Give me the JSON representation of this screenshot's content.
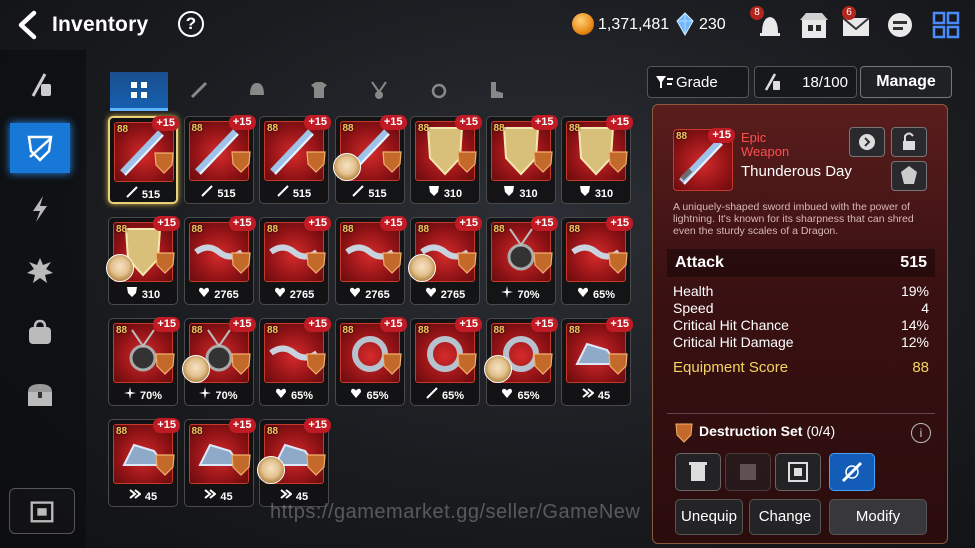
{
  "header": {
    "title": "Inventory",
    "help": "?",
    "gold": "1,371,481",
    "gems": "230",
    "badges": {
      "bell": "8",
      "mail": "6"
    }
  },
  "category_tabs": [
    "all",
    "weapon",
    "helmet",
    "armor",
    "necklace",
    "ring",
    "boots"
  ],
  "toolbar": {
    "filter_label": "Grade",
    "capacity": "18/100",
    "manage_label": "Manage"
  },
  "items": [
    {
      "lv": "88",
      "plus": "+15",
      "stat_icon": "sword",
      "value": "515",
      "hero": false
    },
    {
      "lv": "88",
      "plus": "+15",
      "stat_icon": "sword",
      "value": "515",
      "hero": false
    },
    {
      "lv": "88",
      "plus": "+15",
      "stat_icon": "sword",
      "value": "515",
      "hero": false
    },
    {
      "lv": "88",
      "plus": "+15",
      "stat_icon": "sword",
      "value": "515",
      "hero": true
    },
    {
      "lv": "88",
      "plus": "+15",
      "stat_icon": "shield",
      "value": "310",
      "hero": false
    },
    {
      "lv": "88",
      "plus": "+15",
      "stat_icon": "shield",
      "value": "310",
      "hero": false
    },
    {
      "lv": "88",
      "plus": "+15",
      "stat_icon": "shield",
      "value": "310",
      "hero": false
    },
    {
      "lv": "88",
      "plus": "+15",
      "stat_icon": "shield",
      "value": "310",
      "hero": true
    },
    {
      "lv": "88",
      "plus": "+15",
      "stat_icon": "heart",
      "value": "2765",
      "hero": false
    },
    {
      "lv": "88",
      "plus": "+15",
      "stat_icon": "heart",
      "value": "2765",
      "hero": false
    },
    {
      "lv": "88",
      "plus": "+15",
      "stat_icon": "heart",
      "value": "2765",
      "hero": false
    },
    {
      "lv": "88",
      "plus": "+15",
      "stat_icon": "heart",
      "value": "2765",
      "hero": true
    },
    {
      "lv": "88",
      "plus": "+15",
      "stat_icon": "crit",
      "value": "70%",
      "hero": false
    },
    {
      "lv": "88",
      "plus": "+15",
      "stat_icon": "heart",
      "value": "65%",
      "hero": false
    },
    {
      "lv": "88",
      "plus": "+15",
      "stat_icon": "crit",
      "value": "70%",
      "hero": false
    },
    {
      "lv": "88",
      "plus": "+15",
      "stat_icon": "crit",
      "value": "70%",
      "hero": true
    },
    {
      "lv": "88",
      "plus": "+15",
      "stat_icon": "heart",
      "value": "65%",
      "hero": false
    },
    {
      "lv": "88",
      "plus": "+15",
      "stat_icon": "heart",
      "value": "65%",
      "hero": false
    },
    {
      "lv": "88",
      "plus": "+15",
      "stat_icon": "sword",
      "value": "65%",
      "hero": false
    },
    {
      "lv": "88",
      "plus": "+15",
      "stat_icon": "heart",
      "value": "65%",
      "hero": true
    },
    {
      "lv": "88",
      "plus": "+15",
      "stat_icon": "speed",
      "value": "45",
      "hero": false
    },
    {
      "lv": "88",
      "plus": "+15",
      "stat_icon": "speed",
      "value": "45",
      "hero": false
    },
    {
      "lv": "88",
      "plus": "+15",
      "stat_icon": "speed",
      "value": "45",
      "hero": false
    },
    {
      "lv": "88",
      "plus": "+15",
      "stat_icon": "speed",
      "value": "45",
      "hero": true
    }
  ],
  "detail": {
    "lv": "88",
    "plus": "+15",
    "rarity": "Epic",
    "type": "Weapon",
    "name": "Thunderous Day",
    "description": "A uniquely-shaped sword imbued with the power of lightning. It's known for its sharpness that can shred even the sturdy scales of a Dragon.",
    "main_stat": {
      "label": "Attack",
      "value": "515"
    },
    "substats": [
      {
        "label": "Health",
        "value": "19%"
      },
      {
        "label": "Speed",
        "value": "4"
      },
      {
        "label": "Critical Hit Chance",
        "value": "14%"
      },
      {
        "label": "Critical Hit Damage",
        "value": "12%"
      }
    ],
    "score": {
      "label": "Equipment Score",
      "value": "88"
    },
    "set": {
      "label": "Destruction Set",
      "count": "(0/4)"
    },
    "buttons": {
      "unequip": "Unequip",
      "change": "Change",
      "modify": "Modify"
    }
  },
  "watermark": "https://gamemarket.gg/seller/GameNew",
  "colors": {
    "accent": "#1778d8",
    "panel": "#3b1112",
    "score": "#f3d463",
    "rarity": "#ff4d4d"
  }
}
